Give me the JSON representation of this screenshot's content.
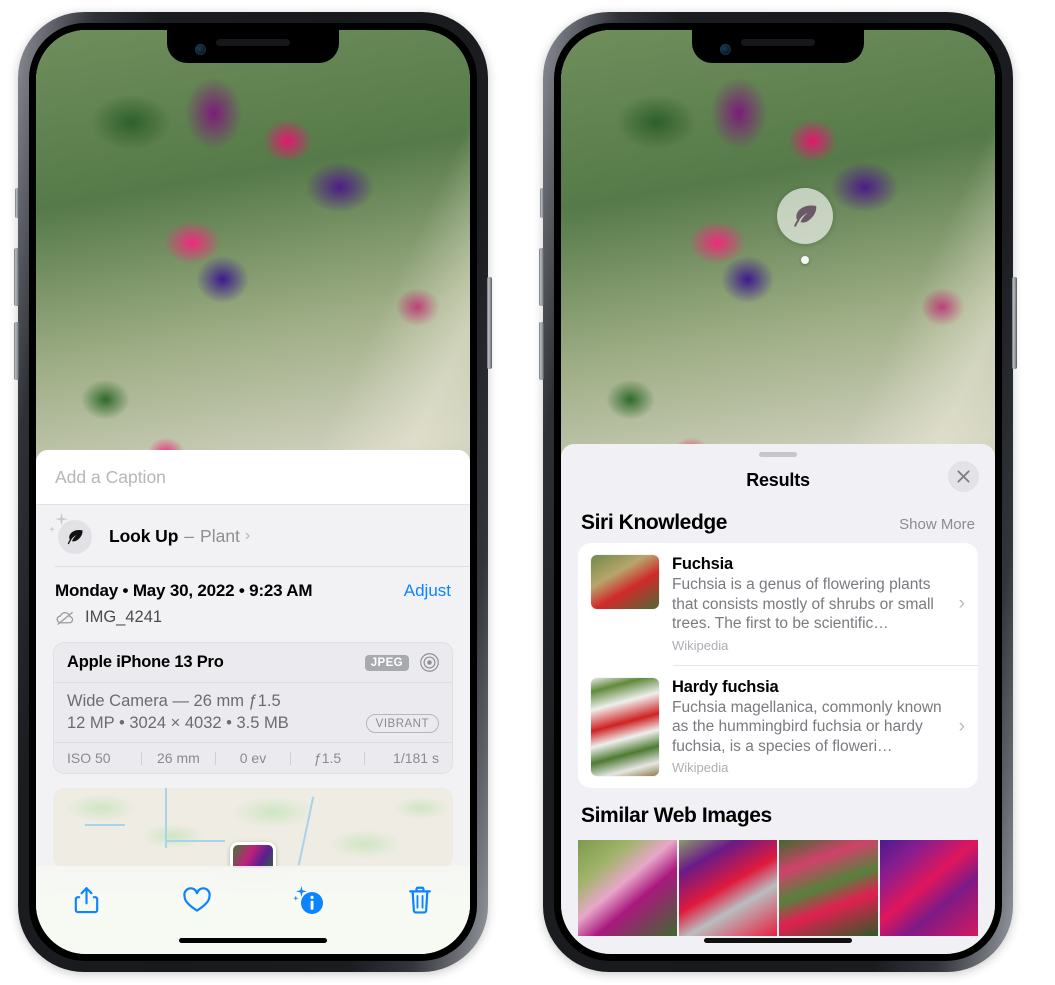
{
  "left_phone": {
    "photo_alt": "fuchsia-flowers-photo",
    "caption_field": {
      "placeholder": "Add a Caption",
      "value": ""
    },
    "look_up": {
      "title": "Look Up",
      "separator": "–",
      "subject": "Plant",
      "chevron": "›",
      "icon": "leaf-icon"
    },
    "date_line": "Monday • May 30, 2022 • 9:23 AM",
    "adjust_label": "Adjust",
    "file_name": "IMG_4241",
    "cloud_icon": "cloud-slash-icon",
    "exif": {
      "device": "Apple iPhone 13 Pro",
      "format_badge": "JPEG",
      "aperture_icon": "aperture-icon",
      "lens_line": "Wide Camera — 26 mm ƒ1.5",
      "size_line": "12 MP • 3024 × 4032 • 3.5 MB",
      "style_badge": "VIBRANT",
      "stats": [
        "ISO 50",
        "26 mm",
        "0 ev",
        "ƒ1.5",
        "1/181 s"
      ]
    },
    "map": {
      "pin": "photo-pin-thumbnail"
    },
    "toolbar": [
      {
        "name": "share-icon",
        "label": "Share"
      },
      {
        "name": "heart-icon",
        "label": "Favorite"
      },
      {
        "name": "info-sparkle-icon",
        "label": "Info"
      },
      {
        "name": "trash-icon",
        "label": "Delete"
      }
    ],
    "accent_color": "#0a84ff"
  },
  "right_phone": {
    "visual_look_up_badge": {
      "icon": "leaf-icon",
      "label": "Visual Look Up"
    },
    "results_sheet": {
      "grabber": "sheet-grabber",
      "title": "Results",
      "close_label": "✕",
      "siri_knowledge": {
        "heading": "Siri Knowledge",
        "show_more": "Show More",
        "items": [
          {
            "title": "Fuchsia",
            "description": "Fuchsia is a genus of flowering plants that consists mostly of shrubs or small trees. The first to be scientific…",
            "source": "Wikipedia",
            "thumb": "fuchsia-thumbnail",
            "chevron": "›"
          },
          {
            "title": "Hardy fuchsia",
            "description": "Fuchsia magellanica, commonly known as the hummingbird fuchsia or hardy fuchsia, is a species of floweri…",
            "source": "Wikipedia",
            "thumb": "hardy-fuchsia-thumbnail",
            "chevron": "›"
          }
        ]
      },
      "similar_web_images": {
        "heading": "Similar Web Images",
        "thumbs": [
          "web-image-1",
          "web-image-2",
          "web-image-3",
          "web-image-4"
        ]
      }
    }
  }
}
